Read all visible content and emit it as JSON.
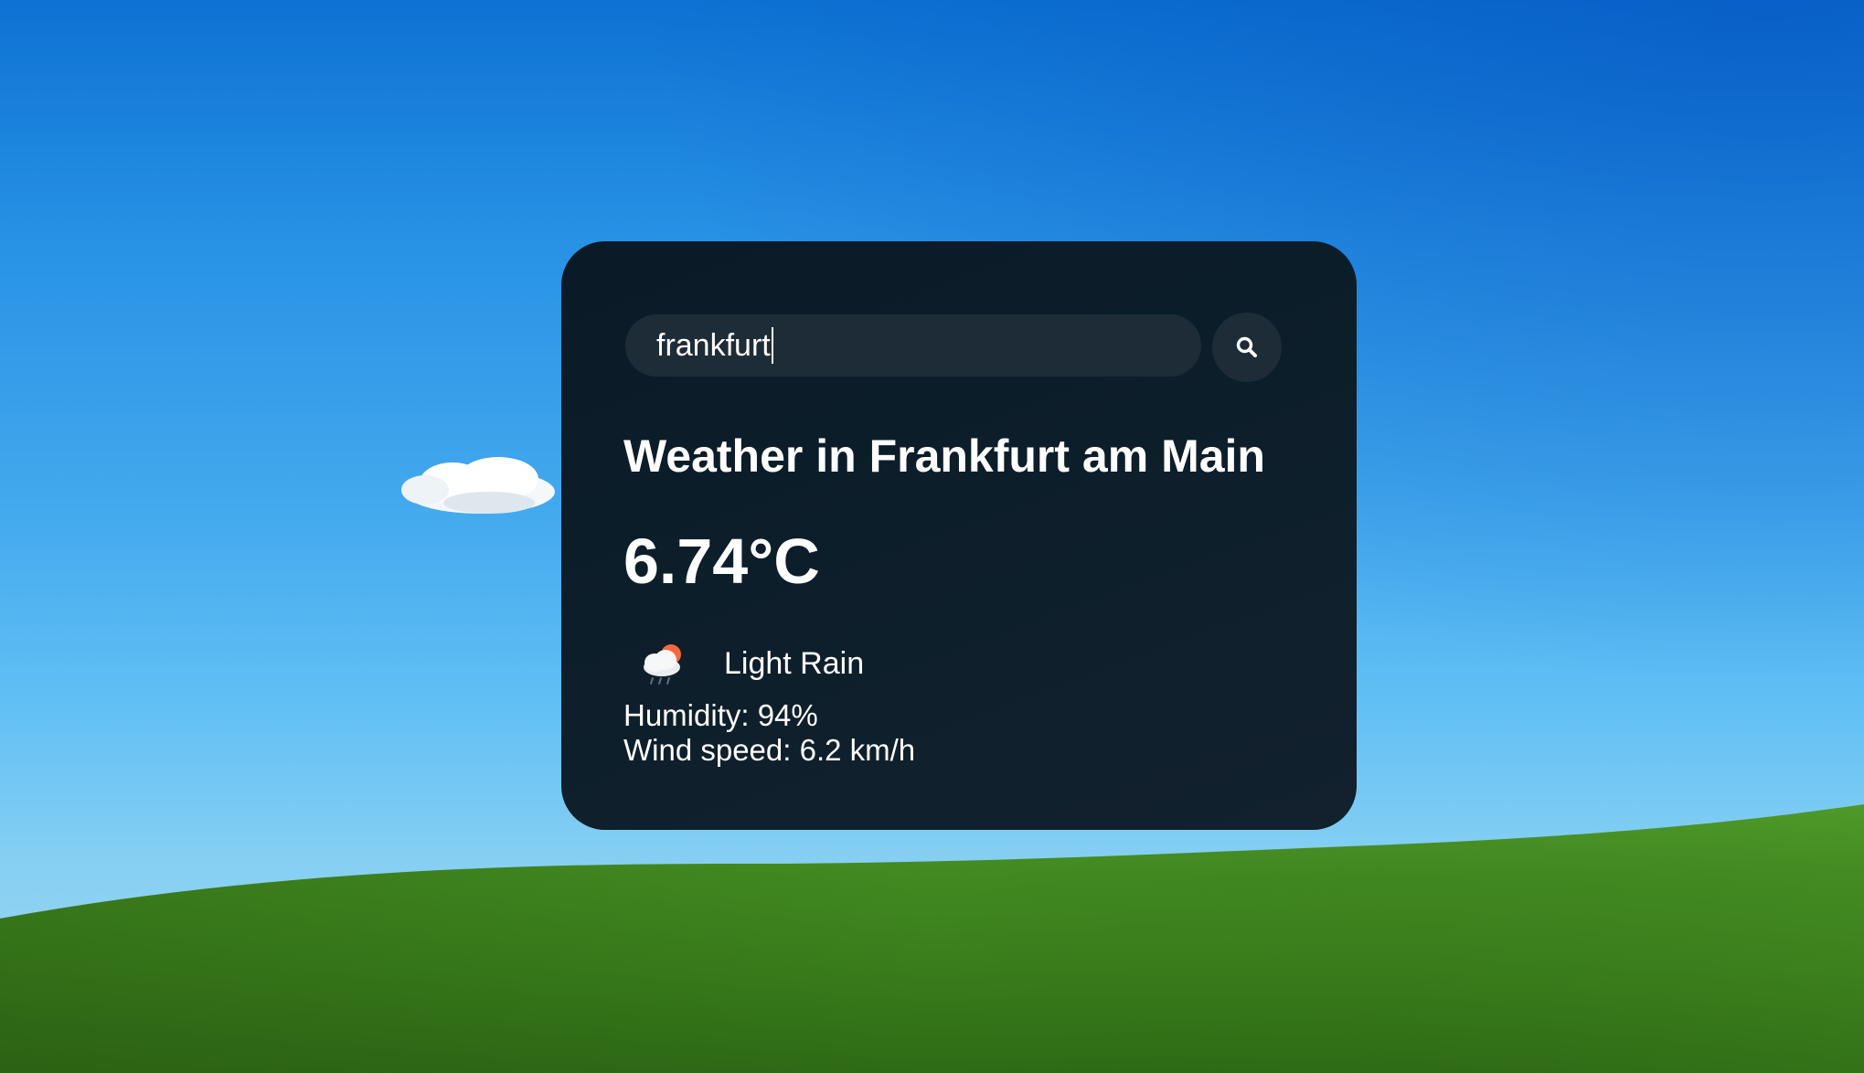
{
  "search": {
    "value": "frankfurt",
    "button_icon": "search-icon"
  },
  "weather": {
    "title": "Weather in Frankfurt am Main",
    "temperature": "6.74°C",
    "condition": "Light Rain",
    "condition_icon": "cloud-sun-rain-icon",
    "humidity": "Humidity: 94%",
    "wind": "Wind speed: 6.2 km/h"
  },
  "colors": {
    "card_background": "#0d1e2b",
    "input_background": "#1e2c37",
    "text": "#ffffff"
  }
}
